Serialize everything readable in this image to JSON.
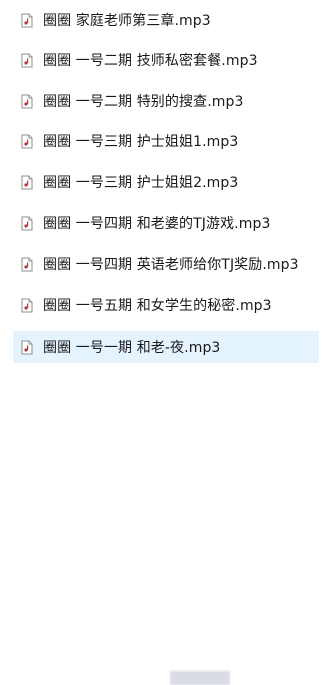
{
  "files": [
    {
      "name": "圈圈 家庭老师第三章.mp3",
      "icon": "audio-file-icon"
    },
    {
      "name": "圈圈 一号二期 技师私密套餐.mp3",
      "icon": "audio-file-icon"
    },
    {
      "name": "圈圈 一号二期 特别的搜查.mp3",
      "icon": "audio-file-icon"
    },
    {
      "name": "圈圈 一号三期 护士姐姐1.mp3",
      "icon": "audio-file-icon"
    },
    {
      "name": "圈圈 一号三期 护士姐姐2.mp3",
      "icon": "audio-file-icon"
    },
    {
      "name": "圈圈 一号四期 和老婆的TJ游戏.mp3",
      "icon": "audio-file-icon"
    },
    {
      "name": "圈圈 一号四期 英语老师给你TJ奖励.mp3",
      "icon": "audio-file-icon"
    },
    {
      "name": "圈圈 一号五期 和女学生的秘密.mp3",
      "icon": "audio-file-icon"
    },
    {
      "name": "圈圈 一号一期 和老-夜.mp3",
      "icon": "audio-file-icon",
      "selected": true
    }
  ],
  "colors": {
    "selection": "#e5f3ff",
    "text": "#1a1a1a",
    "icon_border": "#8c8c8c",
    "icon_accent": "#b03a3a"
  }
}
